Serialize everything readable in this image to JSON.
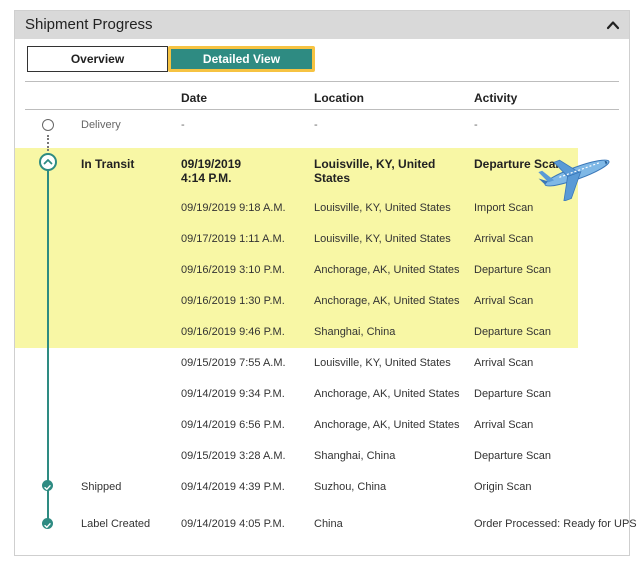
{
  "panel": {
    "title": "Shipment Progress",
    "toggle_icon": "chevron-up-icon"
  },
  "view_toggle": {
    "overview_label": "Overview",
    "detailed_label": "Detailed View",
    "selected": "Detailed View"
  },
  "columns": {
    "date": "Date",
    "location": "Location",
    "activity": "Activity"
  },
  "colors": {
    "accent": "#2e8b82",
    "highlight": "#f8f7a5",
    "focus_ring": "#f6c342"
  },
  "rows": [
    {
      "status": "Delivery",
      "date": "-",
      "location": "-",
      "activity": "-"
    },
    {
      "status": "In Transit",
      "date": "09/19/2019\n4:14 P.M.",
      "location": "Louisville, KY, United States",
      "activity": "Departure Scan"
    },
    {
      "status": "",
      "date": "09/19/2019  9:18 A.M.",
      "location": "Louisville, KY, United States",
      "activity": "Import Scan"
    },
    {
      "status": "",
      "date": "09/17/2019  1:11 A.M.",
      "location": "Louisville, KY, United States",
      "activity": "Arrival Scan"
    },
    {
      "status": "",
      "date": "09/16/2019  3:10 P.M.",
      "location": "Anchorage, AK, United States",
      "activity": "Departure Scan"
    },
    {
      "status": "",
      "date": "09/16/2019  1:30 P.M.",
      "location": "Anchorage, AK, United States",
      "activity": "Arrival Scan"
    },
    {
      "status": "",
      "date": "09/16/2019  9:46 P.M.",
      "location": "Shanghai, China",
      "activity": "Departure Scan"
    },
    {
      "status": "",
      "date": "09/15/2019  7:55 A.M.",
      "location": "Louisville, KY, United States",
      "activity": "Arrival Scan"
    },
    {
      "status": "",
      "date": "09/14/2019  9:34 P.M.",
      "location": "Anchorage, AK, United States",
      "activity": "Departure Scan"
    },
    {
      "status": "",
      "date": "09/14/2019  6:56 P.M.",
      "location": "Anchorage, AK, United States",
      "activity": "Arrival Scan"
    },
    {
      "status": "",
      "date": "09/15/2019  3:28 A.M.",
      "location": "Shanghai, China",
      "activity": "Departure Scan"
    },
    {
      "status": "Shipped",
      "date": "09/14/2019  4:39 P.M.",
      "location": "Suzhou, China",
      "activity": "Origin Scan"
    },
    {
      "status": "Label Created",
      "date": "09/14/2019  4:05 P.M.",
      "location": "China",
      "activity": "Order Processed: Ready for UPS"
    }
  ]
}
